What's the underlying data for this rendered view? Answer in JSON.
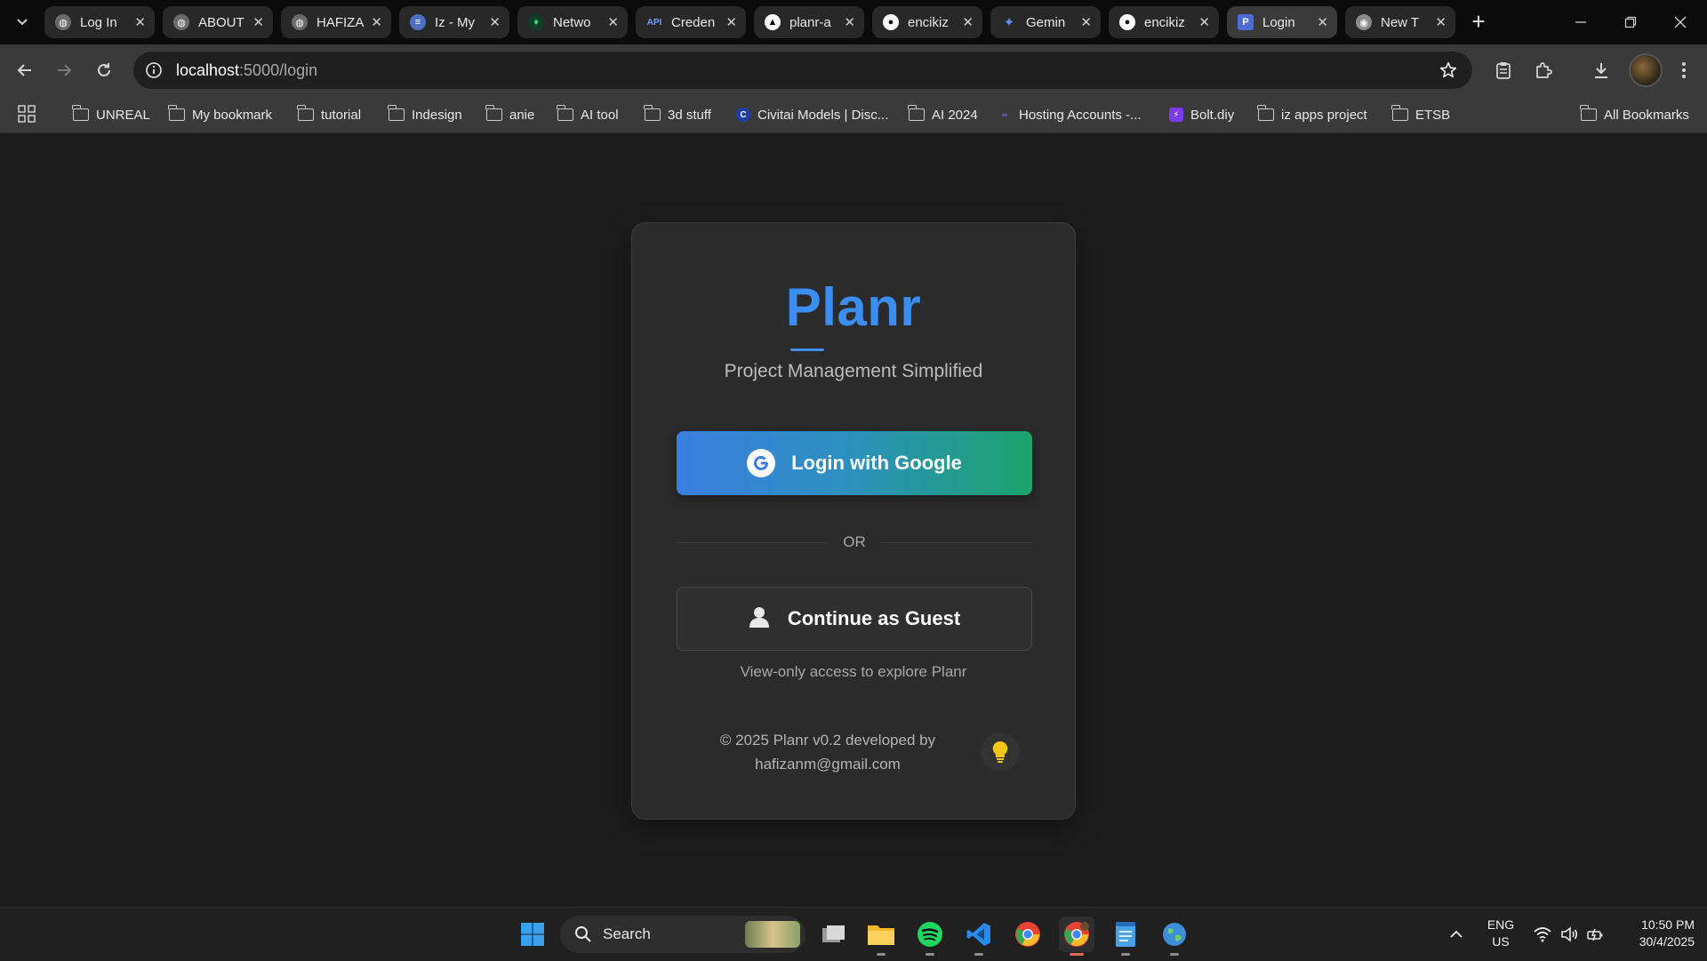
{
  "browser": {
    "tabs": [
      {
        "title": "Log In",
        "favicon": "globe-icon"
      },
      {
        "title": "ABOUT",
        "favicon": "globe-icon"
      },
      {
        "title": "HAFIZA",
        "favicon": "globe-icon"
      },
      {
        "title": "Iz - My",
        "favicon": "doc-icon"
      },
      {
        "title": "Netwo",
        "favicon": "leaf-icon"
      },
      {
        "title": "Creden",
        "favicon": "api-icon"
      },
      {
        "title": "planr-a",
        "favicon": "triangle-icon"
      },
      {
        "title": "encikiz",
        "favicon": "github-icon"
      },
      {
        "title": "Gemin",
        "favicon": "sparkle-icon"
      },
      {
        "title": "encikiz",
        "favicon": "github-icon"
      },
      {
        "title": "Login",
        "favicon": "planr-icon",
        "active": true
      },
      {
        "title": "New T",
        "favicon": "chrome-icon"
      }
    ],
    "url_host": "localhost",
    "url_path": ":5000/login"
  },
  "bookmarks": {
    "items": [
      {
        "label": "UNREAL",
        "type": "folder"
      },
      {
        "label": "My bookmark",
        "type": "folder"
      },
      {
        "label": "tutorial",
        "type": "folder"
      },
      {
        "label": "Indesign",
        "type": "folder"
      },
      {
        "label": "anie",
        "type": "folder"
      },
      {
        "label": "AI tool",
        "type": "folder"
      },
      {
        "label": "3d stuff",
        "type": "folder"
      },
      {
        "label": "Civitai Models | Disc...",
        "type": "site"
      },
      {
        "label": "AI 2024",
        "type": "folder"
      },
      {
        "label": "Hosting Accounts -...",
        "type": "site"
      },
      {
        "label": "Bolt.diy",
        "type": "site"
      },
      {
        "label": "iz apps project",
        "type": "folder"
      },
      {
        "label": "ETSB",
        "type": "folder"
      }
    ],
    "all_label": "All Bookmarks"
  },
  "login": {
    "brand": "Planr",
    "tagline": "Project Management Simplified",
    "google_button": "Login with Google",
    "divider": "OR",
    "guest_button": "Continue as Guest",
    "guest_note": "View-only access to explore Planr",
    "footer_line1": "© 2025 Planr v0.2 developed by",
    "footer_line2": "hafizanm@gmail.com",
    "accent_color": "#3b8df0"
  },
  "taskbar": {
    "search_label": "Search",
    "lang_line1": "ENG",
    "lang_line2": "US",
    "time": "10:50 PM",
    "date": "30/4/2025"
  }
}
